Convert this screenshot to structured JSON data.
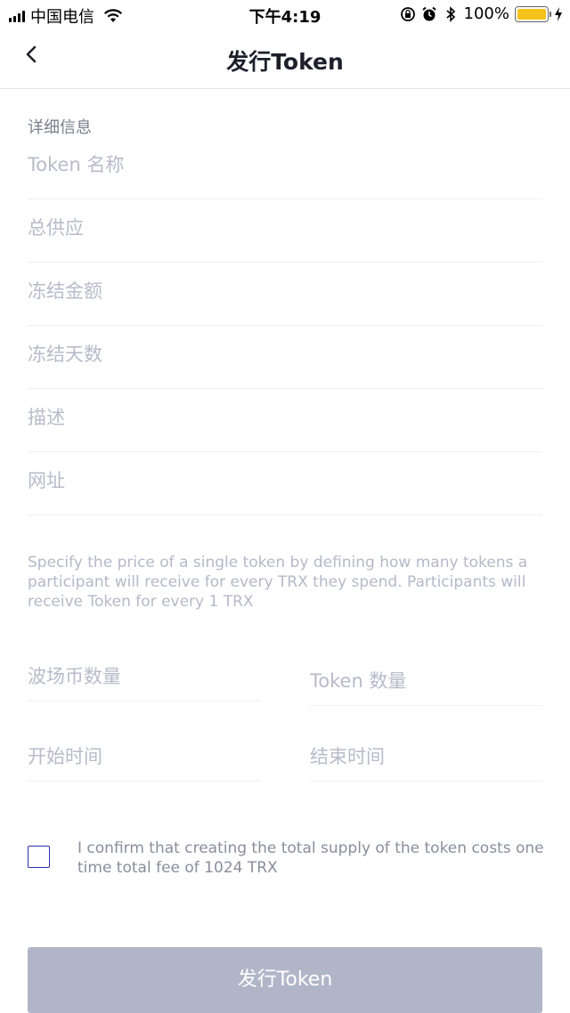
{
  "status_bar": {
    "carrier": "中国电信",
    "time": "下午4:19",
    "battery": "100%",
    "battery_level": 1.0,
    "battery_color": "#f5c21b"
  },
  "nav": {
    "title": "发行Token",
    "back_icon": "chevron-left-icon"
  },
  "form": {
    "section_title": "详细信息",
    "fields": [
      {
        "placeholder": "Token 名称"
      },
      {
        "placeholder": "总供应"
      },
      {
        "placeholder": "冻结金额"
      },
      {
        "placeholder": "冻结天数"
      },
      {
        "placeholder": "描述"
      },
      {
        "placeholder": "网址"
      }
    ],
    "price_hint": "Specify the price of a single token by defining how many tokens a participant will receive for every TRX they spend.  Participants will receive Token for every 1 TRX",
    "trx_amount_placeholder": "波场币数量",
    "token_amount_placeholder": "Token 数量",
    "start_time_placeholder": "开始时间",
    "end_time_placeholder": "结束时间",
    "confirm_text": "I confirm that creating the total supply of the token costs one time total fee of 1024 TRX",
    "confirm_checked": false,
    "submit_label": "发行Token"
  },
  "colors": {
    "accent_checkbox": "#2b2fa8",
    "button_disabled": "#b1b5c8",
    "placeholder": "#b8bbc9"
  }
}
